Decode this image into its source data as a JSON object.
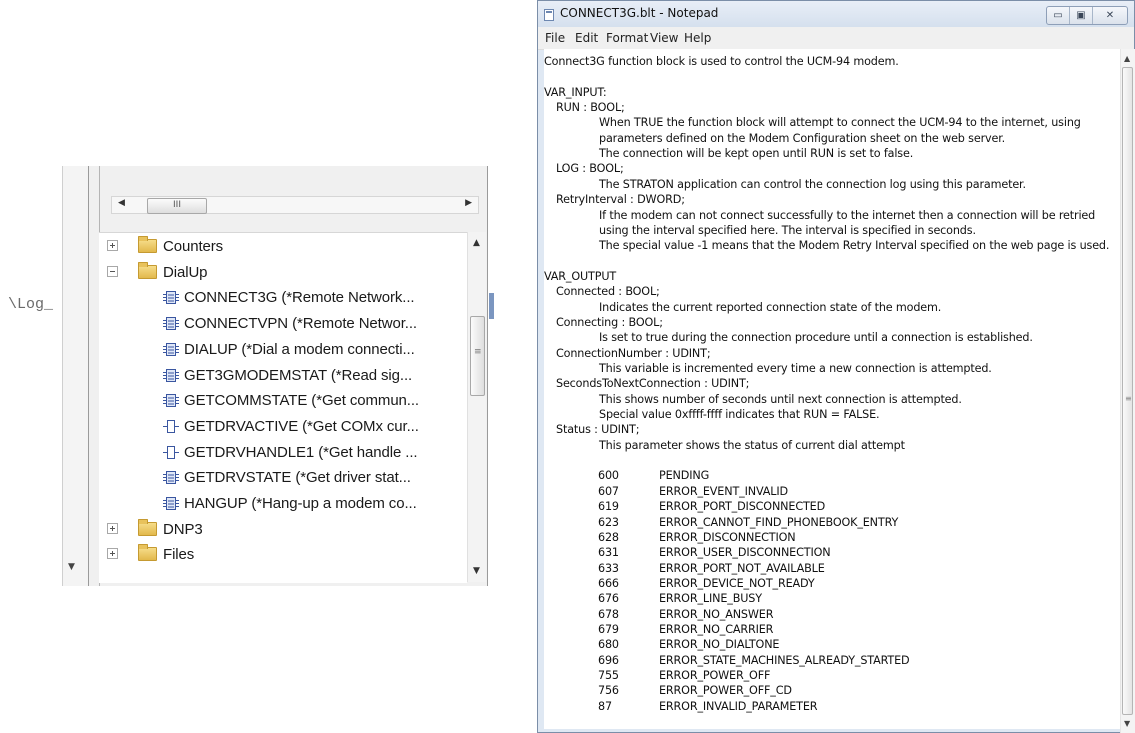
{
  "left_panel": {
    "path_fragment": "\\Log_",
    "hscroll_grip": "III",
    "vscroll_grip": "≡",
    "tree": [
      {
        "type": "folder",
        "expander": "plus",
        "label": "Counters",
        "indent": 0
      },
      {
        "type": "folder",
        "expander": "minus",
        "label": "DialUp",
        "indent": 0
      },
      {
        "type": "fb",
        "icon": "function-block-icon",
        "label": "CONNECT3G (*Remote Network...",
        "indent": 1
      },
      {
        "type": "fb",
        "icon": "function-block-icon",
        "label": "CONNECTVPN (*Remote Networ...",
        "indent": 1
      },
      {
        "type": "fb",
        "icon": "function-block-icon",
        "label": "DIALUP (*Dial a modem connecti...",
        "indent": 1
      },
      {
        "type": "fb",
        "icon": "function-block-icon",
        "label": "GET3GMODEMSTAT (*Read sig...",
        "indent": 1
      },
      {
        "type": "fb",
        "icon": "function-block-icon",
        "label": "GETCOMMSTATE (*Get commun...",
        "indent": 1
      },
      {
        "type": "fn",
        "icon": "function-icon",
        "label": "GETDRVACTIVE (*Get COMx cur...",
        "indent": 1
      },
      {
        "type": "fn",
        "icon": "function-icon",
        "label": "GETDRVHANDLE1 (*Get handle ...",
        "indent": 1
      },
      {
        "type": "fb",
        "icon": "function-block-icon",
        "label": "GETDRVSTATE (*Get driver stat...",
        "indent": 1
      },
      {
        "type": "fb",
        "icon": "function-block-icon",
        "label": "HANGUP (*Hang-up a modem co...",
        "indent": 1
      },
      {
        "type": "folder",
        "expander": "plus",
        "label": "DNP3",
        "indent": 0
      },
      {
        "type": "folder",
        "expander": "plus",
        "label": "Files",
        "indent": 0
      }
    ]
  },
  "notepad": {
    "title": "CONNECT3G.blt - Notepad",
    "window_buttons": {
      "minimize": "▭",
      "maximize": "▣",
      "close": "✕"
    },
    "menu": [
      "File",
      "Edit",
      "Format",
      "View",
      "Help"
    ],
    "lines": [
      {
        "text": "Connect3G function block is used to control the UCM-94 modem.",
        "indent": 0
      },
      {
        "text": "",
        "indent": 0
      },
      {
        "text": "VAR_INPUT:",
        "indent": 0
      },
      {
        "text": "RUN : BOOL;",
        "indent": 1
      },
      {
        "text": "When TRUE the function block will attempt to connect the UCM-94 to the internet, using",
        "indent": 2
      },
      {
        "text": "parameters defined on the Modem Configuration sheet on the web server.",
        "indent": 2
      },
      {
        "text": "The connection will be kept open until RUN is set to false.",
        "indent": 2
      },
      {
        "text": "LOG : BOOL;",
        "indent": 1
      },
      {
        "text": "The STRATON application can control the connection log using this parameter.",
        "indent": 2
      },
      {
        "text": "RetryInterval : DWORD;",
        "indent": 1
      },
      {
        "text": "If the modem can not connect successfully to the internet then a connection will be retried",
        "indent": 2
      },
      {
        "text": "using the interval specified here.  The interval is specified in seconds.",
        "indent": 2
      },
      {
        "text": "The special value -1 means that the Modem Retry Interval specified on the web page is used.",
        "indent": 2
      },
      {
        "text": "",
        "indent": 0
      },
      {
        "text": "VAR_OUTPUT",
        "indent": 0
      },
      {
        "text": "Connected : BOOL;",
        "indent": 1
      },
      {
        "text": "Indicates the current reported connection state of the modem.",
        "indent": 2
      },
      {
        "text": "Connecting : BOOL;",
        "indent": 1
      },
      {
        "text": "Is set to true during the connection procedure until a connection is established.",
        "indent": 2
      },
      {
        "text": "ConnectionNumber : UDINT;",
        "indent": 1
      },
      {
        "text": "This variable is incremented every time a new connection is attempted.",
        "indent": 2
      },
      {
        "text": "SecondsToNextConnection : UDINT;",
        "indent": 1
      },
      {
        "text": "This shows number of seconds until next connection is attempted.",
        "indent": 2
      },
      {
        "text": "Special value 0xffff-ffff indicates that RUN = FALSE.",
        "indent": 2
      },
      {
        "text": "Status : UDINT;",
        "indent": 1
      },
      {
        "text": "This parameter shows the status of current dial attempt",
        "indent": 2
      }
    ],
    "status_codes": [
      {
        "code": "600",
        "name": "PENDING"
      },
      {
        "code": "607",
        "name": "ERROR_EVENT_INVALID"
      },
      {
        "code": "619",
        "name": "ERROR_PORT_DISCONNECTED"
      },
      {
        "code": "623",
        "name": "ERROR_CANNOT_FIND_PHONEBOOK_ENTRY"
      },
      {
        "code": "628",
        "name": "ERROR_DISCONNECTION"
      },
      {
        "code": "631",
        "name": "ERROR_USER_DISCONNECTION"
      },
      {
        "code": "633",
        "name": "ERROR_PORT_NOT_AVAILABLE"
      },
      {
        "code": "666",
        "name": "ERROR_DEVICE_NOT_READY"
      },
      {
        "code": "676",
        "name": "ERROR_LINE_BUSY"
      },
      {
        "code": "678",
        "name": "ERROR_NO_ANSWER"
      },
      {
        "code": "679",
        "name": "ERROR_NO_CARRIER"
      },
      {
        "code": "680",
        "name": "ERROR_NO_DIALTONE"
      },
      {
        "code": "696",
        "name": "ERROR_STATE_MACHINES_ALREADY_STARTED"
      },
      {
        "code": "755",
        "name": "ERROR_POWER_OFF"
      },
      {
        "code": "756",
        "name": "ERROR_POWER_OFF_CD"
      },
      {
        "code": "87",
        "name": "ERROR_INVALID_PARAMETER"
      }
    ]
  }
}
